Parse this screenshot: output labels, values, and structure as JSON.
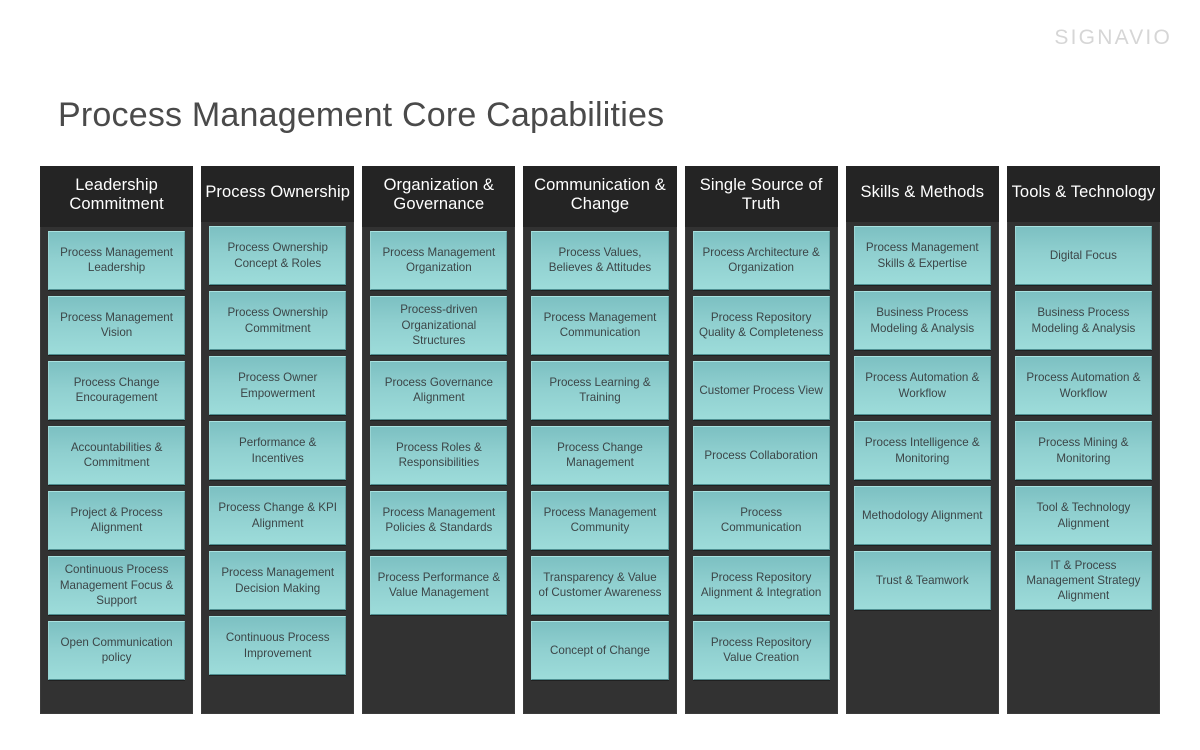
{
  "brand": {
    "logo_text": "SIGNAVIO"
  },
  "title": "Process Management Core Capabilities",
  "colors": {
    "background": "#ffffff",
    "title_text": "#4a4a4a",
    "logo_text": "#d6d6d6",
    "column_body": "#323232",
    "column_header": "#242424",
    "header_text": "#ffffff",
    "tile_top": "#7cc0c2",
    "tile_bottom": "#9ddcda",
    "tile_text": "#3c4547"
  },
  "columns": [
    {
      "header": "Leadership Commitment",
      "items": [
        "Process Management Leadership",
        "Process Management Vision",
        "Process Change Encouragement",
        "Accountabilities & Commitment",
        "Project & Process Alignment",
        "Continuous Process Management Focus & Support",
        "Open Communication policy"
      ]
    },
    {
      "header": "Process Ownership",
      "items": [
        "Process Ownership Concept & Roles",
        "Process Ownership Commitment",
        "Process Owner Empowerment",
        "Performance & Incentives",
        "Process Change & KPI Alignment",
        "Process Management Decision Making",
        "Continuous Process Improvement"
      ]
    },
    {
      "header": "Organization & Governance",
      "items": [
        "Process Management Organization",
        "Process-driven Organizational Structures",
        "Process Governance Alignment",
        "Process Roles & Responsibilities",
        "Process Management Policies & Standards",
        "Process Performance & Value Management"
      ]
    },
    {
      "header": "Communication & Change",
      "items": [
        "Process Values, Believes & Attitudes",
        "Process Management Communication",
        "Process Learning & Training",
        "Process Change Management",
        "Process Management Community",
        "Transparency & Value of Customer Awareness",
        "Concept of Change"
      ]
    },
    {
      "header": "Single Source of Truth",
      "items": [
        "Process Architecture & Organization",
        "Process Repository Quality & Completeness",
        "Customer Process View",
        "Process Collaboration",
        "Process Communication",
        "Process Repository Alignment & Integration",
        "Process Repository Value Creation"
      ]
    },
    {
      "header": "Skills & Methods",
      "items": [
        "Process Management Skills & Expertise",
        "Business Process Modeling & Analysis",
        "Process Automation & Workflow",
        "Process Intelligence & Monitoring",
        "Methodology Alignment",
        "Trust & Teamwork"
      ]
    },
    {
      "header": "Tools & Technology",
      "items": [
        "Digital Focus",
        "Business Process Modeling & Analysis",
        "Process Automation & Workflow",
        "Process Mining & Monitoring",
        "Tool & Technology Alignment",
        "IT & Process Management Strategy Alignment"
      ]
    }
  ]
}
